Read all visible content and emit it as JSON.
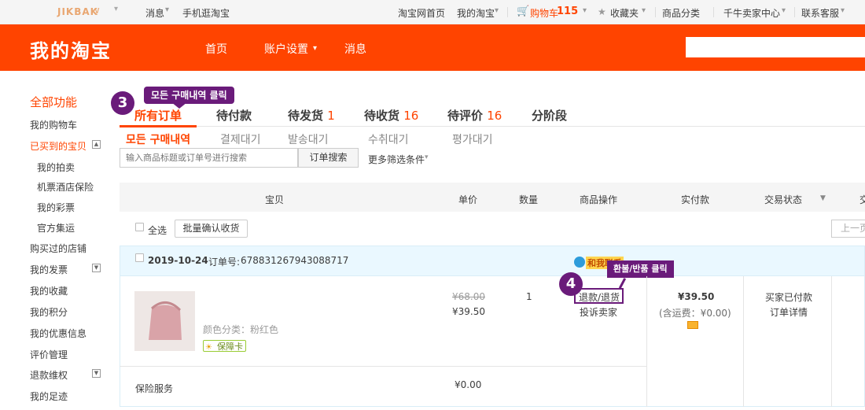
{
  "topbar": {
    "logo": "JIKBAK",
    "logo_caret": "∨",
    "messages": "消息",
    "mobile": "手机逛淘宝",
    "home": "淘宝网首页",
    "my_taobao": "我的淘宝",
    "cart": "购物车",
    "cart_count": "115",
    "favorites": "收藏夹",
    "categories": "商品分类",
    "seller_center": "千牛卖家中心",
    "service": "联系客服",
    "caret": "▾"
  },
  "header": {
    "logo": "我的淘宝",
    "nav_home": "首页",
    "nav_account": "账户设置",
    "nav_messages": "消息",
    "search_value": ""
  },
  "sidebar": {
    "title": "全部功能",
    "cart": "我的购物车",
    "bought": "已买到的宝贝",
    "auction": "我的拍卖",
    "travel": "机票酒店保险",
    "lottery": "我的彩票",
    "jiyun": "官方集运",
    "shops": "购买过的店铺",
    "invoice": "我的发票",
    "collection": "我的收藏",
    "points": "我的积分",
    "coupons": "我的优惠信息",
    "reviews": "评价管理",
    "refund": "退款维权",
    "footprint": "我的足迹"
  },
  "tabs": {
    "all": "所有订单",
    "unpaid": "待付款",
    "unshipped": "待发货",
    "unshipped_count": "1",
    "unreceived": "待收货",
    "unreceived_count": "16",
    "unrated": "待评价",
    "unrated_count": "16",
    "installment": "分阶段"
  },
  "subtabs": {
    "all": "모든 구매내역",
    "unpaid": "결제대기",
    "unshipped": "발송대기",
    "unreceived": "수취대기",
    "unrated": "평가대기"
  },
  "search": {
    "placeholder": "输入商品标题或订单号进行搜索",
    "button": "订单搜索",
    "more": "更多筛选条件"
  },
  "table": {
    "item": "宝贝",
    "price": "单价",
    "qty": "数量",
    "ops": "商品操作",
    "paid": "实付款",
    "status": "交易状态",
    "extra": "交"
  },
  "actions": {
    "select_all": "全选",
    "batch": "批量确认收货",
    "prev": "上一页"
  },
  "order": {
    "date": "2019-10-24",
    "order_no_label": "订单号:",
    "order_no": "678831267943088717",
    "chat": "和我联系",
    "variant": "颜色分类：粉红色",
    "guarantee": "保障卡",
    "orig_price": "¥68.00",
    "price": "¥39.50",
    "qty": "1",
    "refund": "退款/退货",
    "complain": "投诉卖家",
    "total": "¥39.50",
    "shipping": "(含运费：¥0.00)",
    "state": "买家已付款",
    "detail": "订单详情",
    "insurance": "保险服务",
    "insurance_price": "¥0.00"
  },
  "annotations": {
    "step3": "3",
    "step3_label": "모든 구매내역 클릭",
    "step4": "4",
    "step4_label": "환불/반품 클릭"
  },
  "colors": {
    "brand": "#ff4400",
    "annotation": "#6a1b7a",
    "order_row_bg": "#eaf8ff"
  }
}
